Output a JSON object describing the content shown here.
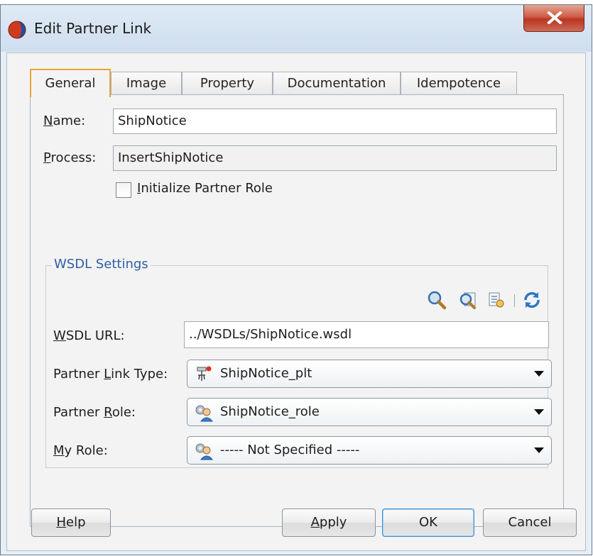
{
  "window": {
    "title": "Edit Partner Link"
  },
  "tabs": [
    {
      "label": "General",
      "active": true
    },
    {
      "label": "Image",
      "active": false
    },
    {
      "label": "Property",
      "active": false
    },
    {
      "label": "Documentation",
      "active": false
    },
    {
      "label": "Idempotence",
      "active": false
    }
  ],
  "general": {
    "name_label_mnemonic": "N",
    "name_label_rest": "ame:",
    "name_value": "ShipNotice",
    "process_label_mnemonic": "P",
    "process_label_rest": "rocess:",
    "process_value": "InsertShipNotice",
    "init_role_mnemonic": "I",
    "init_role_rest": "nitialize Partner Role",
    "init_role_checked": false
  },
  "wsdl": {
    "group_title": "WSDL Settings",
    "toolbar_icons": [
      "search-icon",
      "browse-wsdl-icon",
      "service-explorer-icon",
      "refresh-icon"
    ],
    "url_label_mnemonic": "W",
    "url_label_rest": "SDL URL:",
    "url_value": "../WSDLs/ShipNotice.wsdl",
    "plt_label_before": "Partner ",
    "plt_label_mnemonic": "L",
    "plt_label_after": "ink Type:",
    "plt_value": "ShipNotice_plt",
    "prole_label_before": "Partner ",
    "prole_label_mnemonic": "R",
    "prole_label_after": "ole:",
    "prole_value": "ShipNotice_role",
    "myrole_label_mnemonic": "M",
    "myrole_label_rest": "y Role:",
    "myrole_value": "----- Not Specified -----"
  },
  "buttons": {
    "help_mnemonic": "H",
    "help_rest": "elp",
    "apply_mnemonic": "A",
    "apply_rest": "pply",
    "ok": "OK",
    "cancel": "Cancel"
  },
  "colors": {
    "accent_tab": "#e8a33b",
    "group_title": "#2f5fa6",
    "close_button": "#c7452f",
    "default_button_border": "#3d8fd0"
  }
}
